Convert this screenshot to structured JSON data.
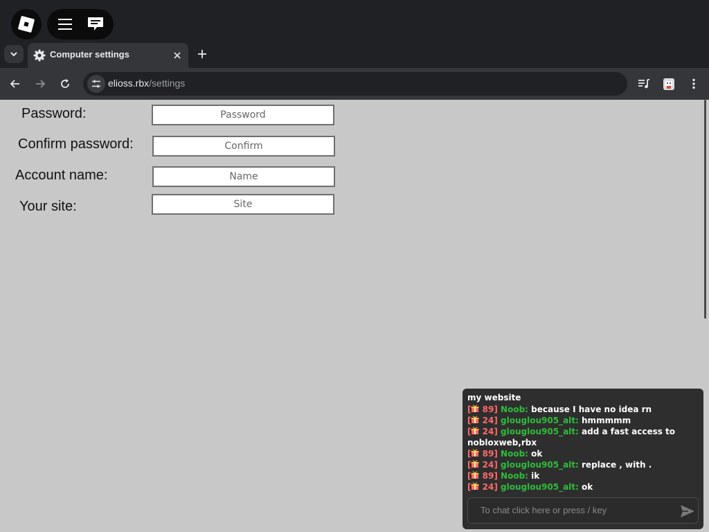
{
  "tab": {
    "title": "Computer settings"
  },
  "address": {
    "host": "elioss.rbx",
    "path": "/settings"
  },
  "form": {
    "fields": [
      {
        "label": "Password:",
        "placeholder": "Password"
      },
      {
        "label": "Confirm password:",
        "placeholder": "Confirm"
      },
      {
        "label": "Account name:",
        "placeholder": "Name"
      },
      {
        "label": "Your site:",
        "placeholder": "Site"
      }
    ]
  },
  "chat": {
    "header": "my website",
    "messages": [
      {
        "level": "89",
        "user": "Noob:",
        "text": "because I have no idea rn"
      },
      {
        "level": "24",
        "user": "glouglou905_alt:",
        "text": "hmmmmm"
      },
      {
        "level": "24",
        "user": "glouglou905_alt:",
        "text": "add a fast access to nobloxweb,rbx"
      },
      {
        "level": "89",
        "user": "Noob:",
        "text": "ok"
      },
      {
        "level": "24",
        "user": "glouglou905_alt:",
        "text": "replace , with ."
      },
      {
        "level": "89",
        "user": "Noob:",
        "text": "ik"
      },
      {
        "level": "24",
        "user": "glouglou905_alt:",
        "text": "ok"
      }
    ],
    "input_placeholder": "To chat click here or press / key"
  },
  "colors": {
    "gift_tag": "#ff6a6a",
    "username": "#2ebd3a",
    "page_bg": "#c8c8c8",
    "chrome_bg": "#202124"
  },
  "icons": [
    "roblox-logo-icon",
    "hamburger-menu-icon",
    "chat-icon",
    "chevron-down-icon",
    "gear-icon",
    "close-icon",
    "plus-icon",
    "back-arrow-icon",
    "forward-arrow-icon",
    "reload-icon",
    "tune-icon",
    "media-control-icon",
    "extension-icon",
    "kebab-menu-icon",
    "gift-icon",
    "send-icon"
  ]
}
